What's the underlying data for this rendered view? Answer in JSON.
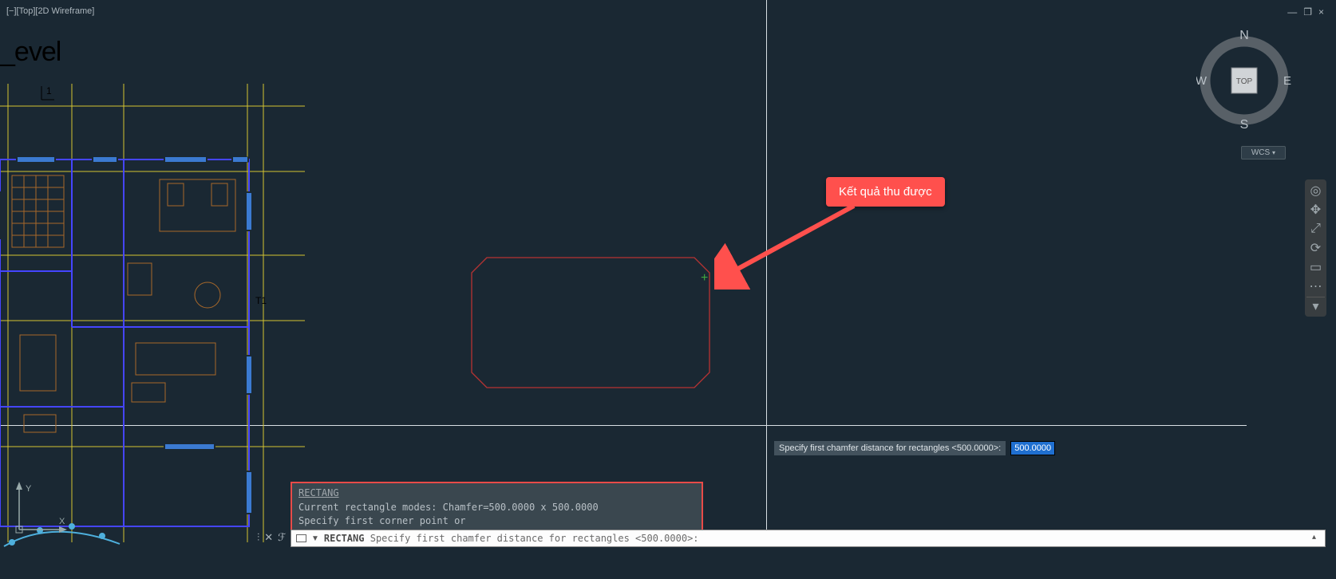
{
  "view_label": "[−][Top][2D Wireframe]",
  "level_text": "_evel",
  "window_controls": {
    "min": "—",
    "restore": "❐",
    "close": "×"
  },
  "viewcube": {
    "n": "N",
    "e": "E",
    "s": "S",
    "w": "W",
    "face": "TOP"
  },
  "wcs_label": "WCS",
  "annotation_text": "Kết quả thu được",
  "dyn_prompt": "Specify first chamfer distance for rectangles <500.0000>:",
  "dyn_value": "500.0000",
  "cmd_history": {
    "line1": "RECTANG",
    "line2": "Current rectangle modes:  Chamfer=500.0000 x 500.0000",
    "line3": "Specify first corner point or [Chamfer/Elevation/Fillet/Thickness/Width]: c"
  },
  "cmd_line_icon_arrow": "▼",
  "cmd_line_cmd": "RECTANG",
  "cmd_line_prompt": "Specify first chamfer distance for rectangles <500.0000>:",
  "marker_1a": "1",
  "marker_1b": "T1"
}
